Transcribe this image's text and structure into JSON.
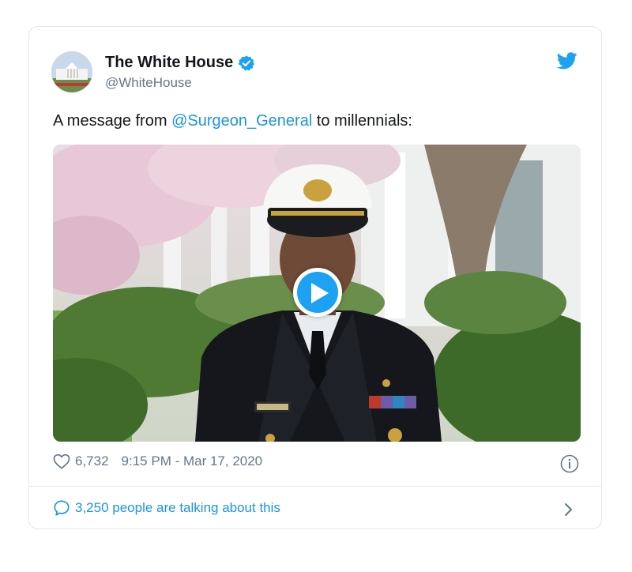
{
  "tweet": {
    "display_name": "The White House",
    "handle": "@WhiteHouse",
    "text_before": "A message from ",
    "mention": "@Surgeon_General",
    "text_after": " to millennials:",
    "likes": "6,732",
    "timestamp": "9:15 PM - Mar 17, 2020",
    "talking": "3,250 people are talking about this"
  },
  "icons": {
    "verified": "verified-badge-icon",
    "brand": "twitter-bird-icon",
    "play": "play-icon",
    "like": "heart-icon",
    "info": "info-icon",
    "reply": "speech-bubble-icon",
    "chevron": "chevron-right-icon"
  },
  "colors": {
    "accent": "#1da1f2",
    "link": "#1b95e0",
    "muted": "#657786",
    "border": "#e1e8ed",
    "text": "#14171a"
  }
}
